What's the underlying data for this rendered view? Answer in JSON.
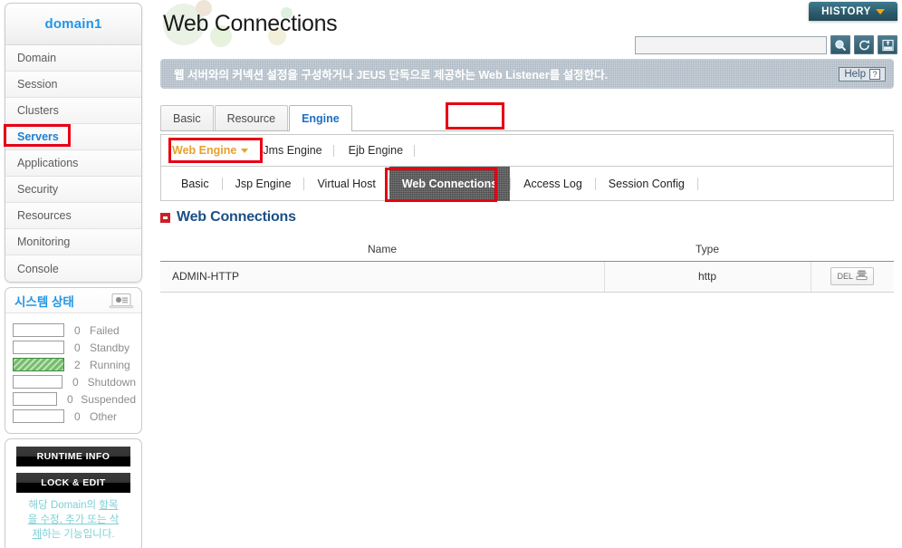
{
  "sidebar": {
    "domain_title": "domain1",
    "nav_items": [
      {
        "label": "Domain",
        "selected": false
      },
      {
        "label": "Session",
        "selected": false
      },
      {
        "label": "Clusters",
        "selected": false
      },
      {
        "label": "Servers",
        "selected": true
      },
      {
        "label": "Applications",
        "selected": false
      },
      {
        "label": "Security",
        "selected": false
      },
      {
        "label": "Resources",
        "selected": false
      },
      {
        "label": "Monitoring",
        "selected": false
      },
      {
        "label": "Console",
        "selected": false
      }
    ],
    "system_status": {
      "title": "시스템 상태",
      "icon": "laptop-chart-icon",
      "rows": [
        {
          "count": "0",
          "name": "Failed",
          "filled": false
        },
        {
          "count": "0",
          "name": "Standby",
          "filled": false
        },
        {
          "count": "2",
          "name": "Running",
          "filled": true
        },
        {
          "count": "0",
          "name": "Shutdown",
          "filled": false
        },
        {
          "count": "0",
          "name": "Suspended",
          "filled": false
        },
        {
          "count": "0",
          "name": "Other",
          "filled": false
        }
      ],
      "running_bar_color": "#74bd6b"
    },
    "runtime_info_label": "RUNTIME INFO",
    "lock_edit_label": "LOCK & EDIT",
    "help_text_line1_a": "해당 Domain의 ",
    "help_text_line1_b": "항목",
    "help_text_line2": "을 수정, 추가 또는 삭",
    "help_text_line3_a": "제",
    "help_text_line3_b": "하는 기능입니다."
  },
  "header": {
    "page_title": "Web Connections",
    "history_label": "HISTORY",
    "history_caret_color": "#f6a700",
    "search_value": "",
    "search_placeholder": "",
    "tools": [
      {
        "name": "search-icon"
      },
      {
        "name": "refresh-icon"
      },
      {
        "name": "xml-export-icon"
      }
    ],
    "description": "웹 서버와의 커넥션 설정을 구성하거나 JEUS 단독으로 제공하는 Web Listener를 설정한다.",
    "help_label": "Help",
    "help_mark": "?"
  },
  "tabs_level1": [
    {
      "label": "Basic",
      "active": false
    },
    {
      "label": "Resource",
      "active": false
    },
    {
      "label": "Engine",
      "active": true,
      "highlighted": true
    }
  ],
  "engine_selector": {
    "items": [
      {
        "label": "Web Engine",
        "selected": true,
        "dropdown": true,
        "highlighted": true
      },
      {
        "label": "Jms Engine",
        "selected": false,
        "dropdown": false
      },
      {
        "label": "Ejb Engine",
        "selected": false,
        "dropdown": false
      }
    ],
    "selected_color": "#e8a02c"
  },
  "tabs_level2": [
    {
      "label": "Basic",
      "active": false
    },
    {
      "label": "Jsp Engine",
      "active": false
    },
    {
      "label": "Virtual Host",
      "active": false
    },
    {
      "label": "Web Connections",
      "active": true,
      "highlighted": true
    },
    {
      "label": "Access Log",
      "active": false
    },
    {
      "label": "Session Config",
      "active": false
    }
  ],
  "section": {
    "icon": "red-square-bullet-icon",
    "title": "Web Connections"
  },
  "table": {
    "columns": [
      "Name",
      "Type",
      ""
    ],
    "rows": [
      {
        "name": "ADMIN-HTTP",
        "type": "http",
        "action_label": "DEL",
        "action_icon": "delete-stack-icon"
      }
    ]
  },
  "highlight_color": "#e60012"
}
